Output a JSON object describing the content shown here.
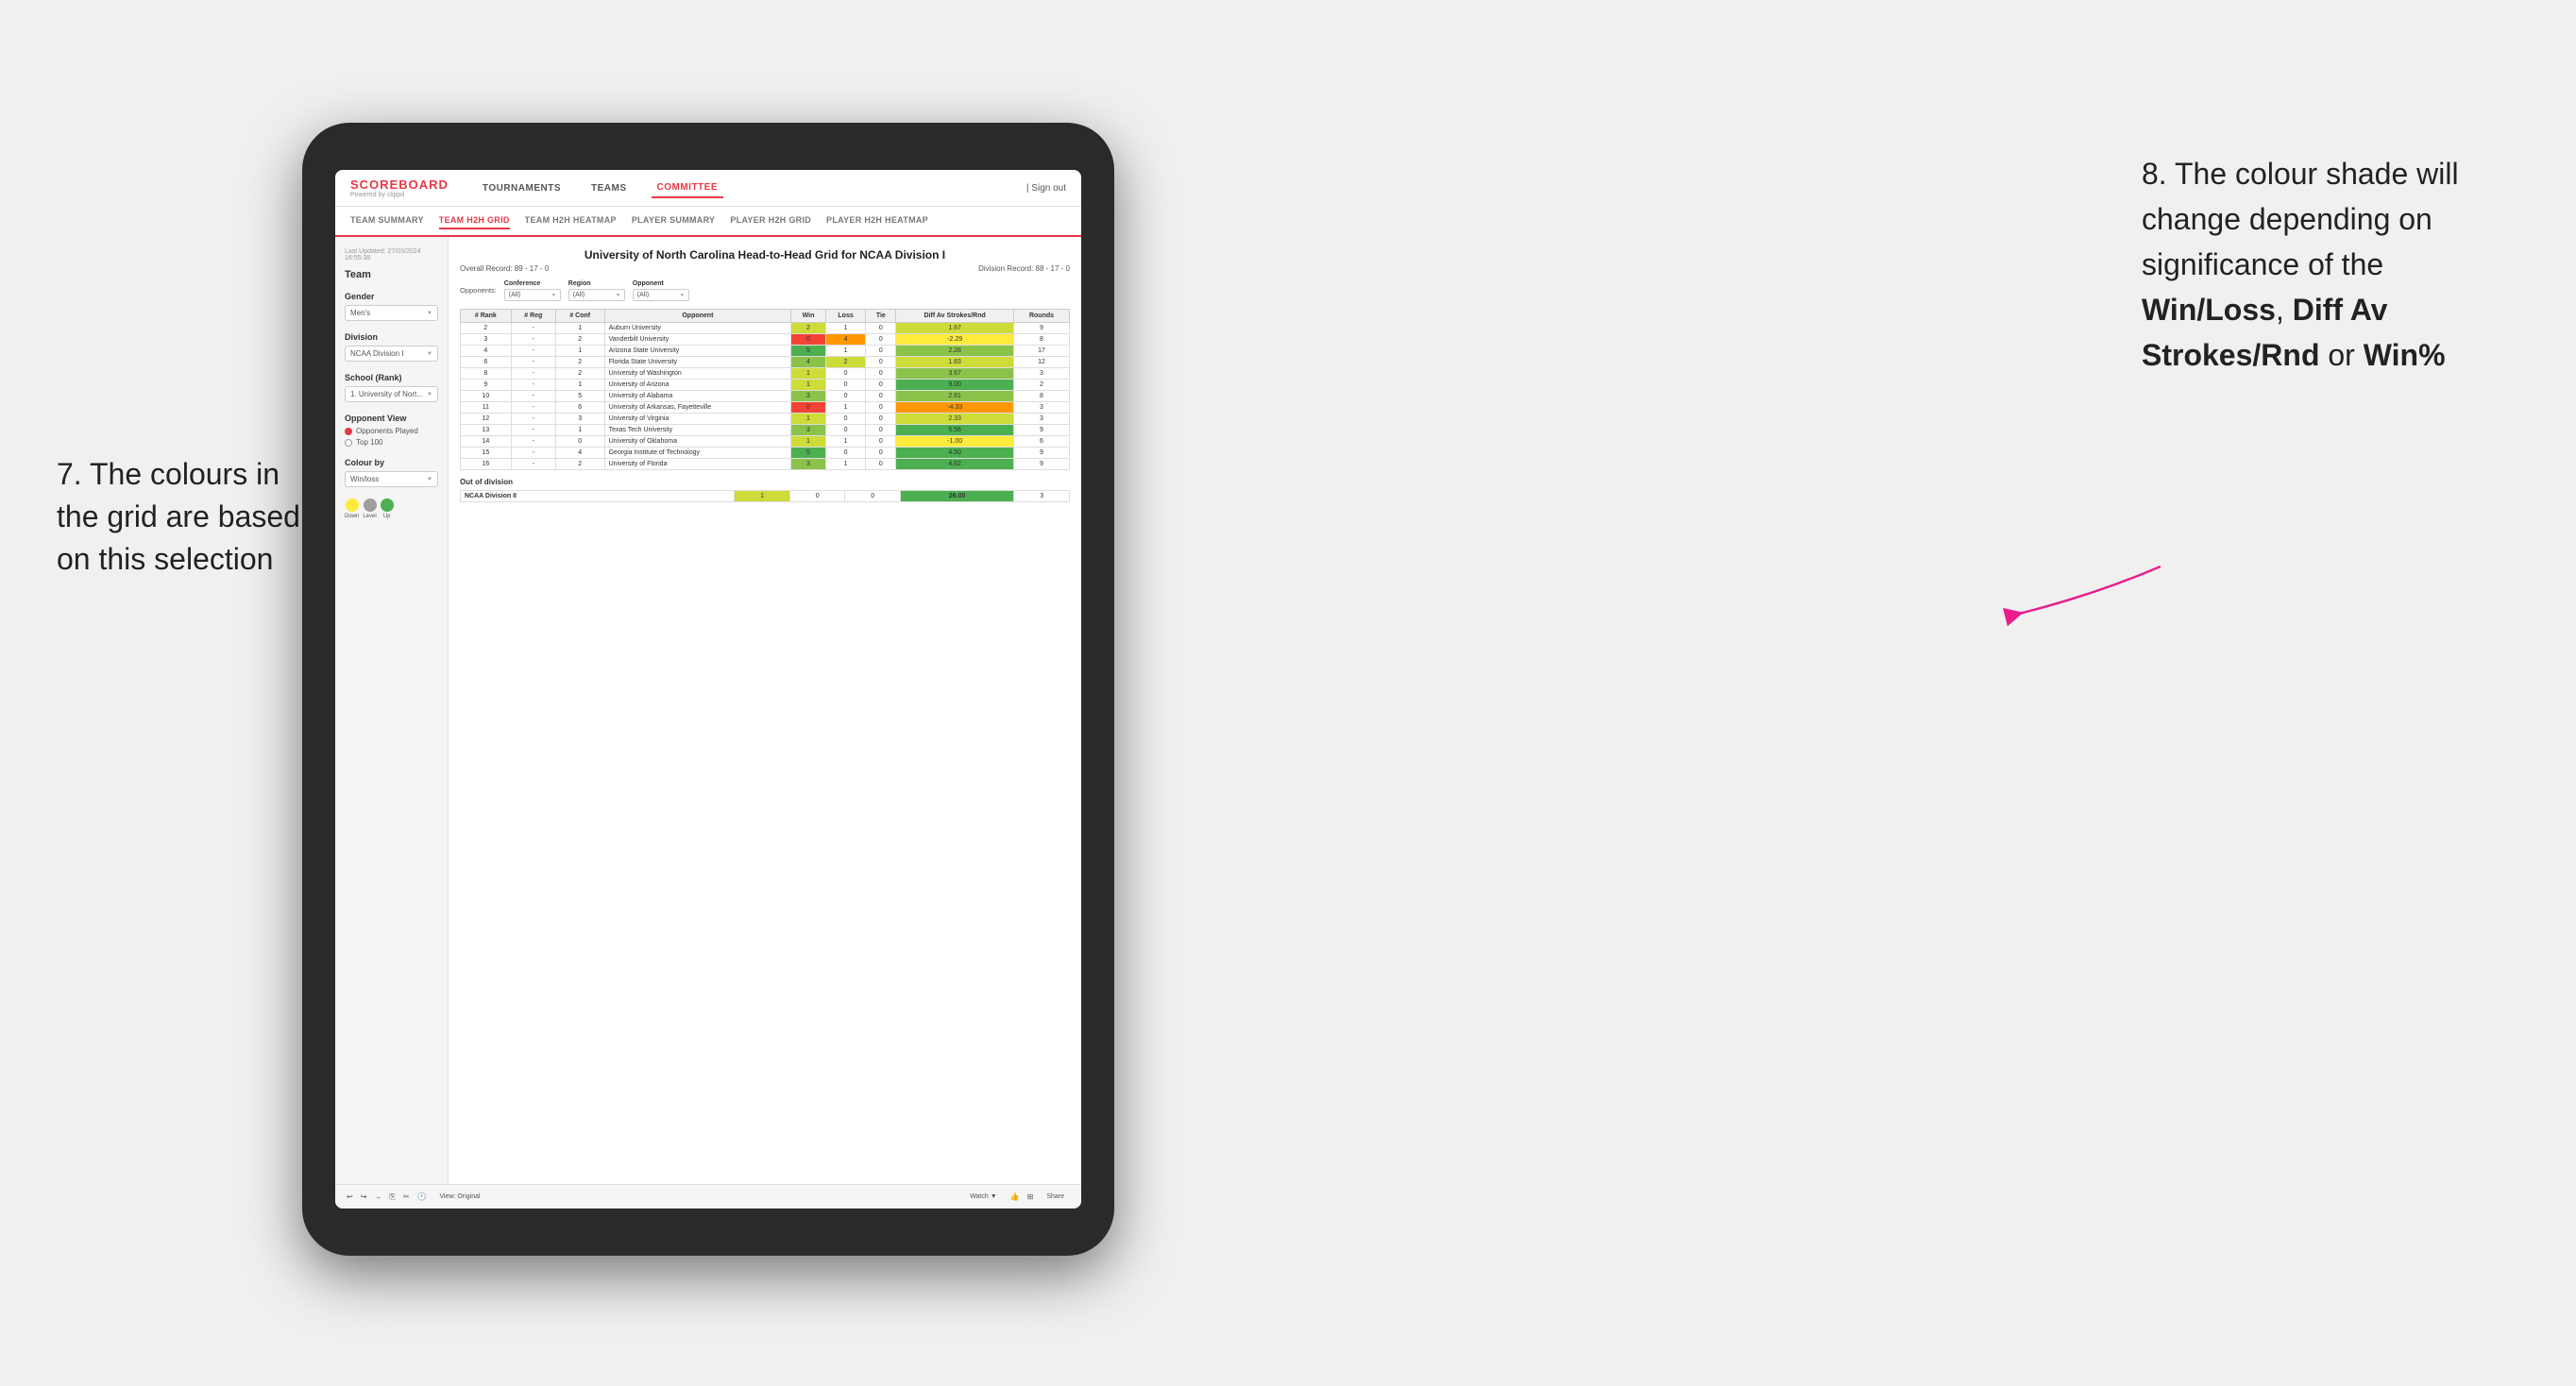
{
  "annotations": {
    "left": {
      "text": "7. The colours in the grid are based on this selection"
    },
    "right": {
      "line1": "8. The colour shade will change depending on significance of the ",
      "bold1": "Win/Loss",
      "sep1": ", ",
      "bold2": "Diff Av Strokes/Rnd",
      "sep2": " or ",
      "bold3": "Win%"
    }
  },
  "nav": {
    "logo": "SCOREBOARD",
    "logo_sub": "Powered by clippd",
    "items": [
      "TOURNAMENTS",
      "TEAMS",
      "COMMITTEE"
    ],
    "sign_out": "Sign out"
  },
  "sub_nav": {
    "items": [
      "TEAM SUMMARY",
      "TEAM H2H GRID",
      "TEAM H2H HEATMAP",
      "PLAYER SUMMARY",
      "PLAYER H2H GRID",
      "PLAYER H2H HEATMAP"
    ]
  },
  "sidebar": {
    "timestamp": "Last Updated: 27/03/2024\n16:55:38",
    "team_label": "Team",
    "gender_label": "Gender",
    "gender_value": "Men's",
    "division_label": "Division",
    "division_value": "NCAA Division I",
    "school_label": "School (Rank)",
    "school_value": "1. University of Nort...",
    "opponent_view_label": "Opponent View",
    "radio_options": [
      "Opponents Played",
      "Top 100"
    ],
    "radio_selected": 0,
    "colour_by_label": "Colour by",
    "colour_by_value": "Win/loss",
    "legend": {
      "down_label": "Down",
      "level_label": "Level",
      "up_label": "Up"
    }
  },
  "report": {
    "title": "University of North Carolina Head-to-Head Grid for NCAA Division I",
    "overall_record": "Overall Record: 89 - 17 - 0",
    "division_record": "Division Record: 88 - 17 - 0",
    "filter_labels": {
      "opponents": "Opponents:",
      "conference": "Conference",
      "region": "Region",
      "opponent": "Opponent"
    },
    "filter_values": {
      "opponents": "(All)",
      "conference": "(All)",
      "region": "(All)",
      "opponent": "(All)"
    },
    "table_headers": [
      "#\nRank",
      "#\nReg",
      "#\nConf",
      "Opponent",
      "Win",
      "Loss",
      "Tie",
      "Diff Av\nStrokes/Rnd",
      "Rounds"
    ],
    "rows": [
      {
        "rank": "2",
        "reg": "-",
        "conf": "1",
        "opponent": "Auburn University",
        "win": "2",
        "loss": "1",
        "tie": "0",
        "diff": "1.67",
        "rounds": "9",
        "win_color": "green_light",
        "loss_color": "white",
        "diff_color": "green_light"
      },
      {
        "rank": "3",
        "reg": "-",
        "conf": "2",
        "opponent": "Vanderbilt University",
        "win": "0",
        "loss": "4",
        "tie": "0",
        "diff": "-2.29",
        "rounds": "8",
        "win_color": "red",
        "loss_color": "orange",
        "diff_color": "yellow"
      },
      {
        "rank": "4",
        "reg": "-",
        "conf": "1",
        "opponent": "Arizona State University",
        "win": "5",
        "loss": "1",
        "tie": "0",
        "diff": "2.28",
        "rounds": "17",
        "win_color": "green_dark",
        "loss_color": "white",
        "diff_color": "green_med"
      },
      {
        "rank": "6",
        "reg": "-",
        "conf": "2",
        "opponent": "Florida State University",
        "win": "4",
        "loss": "2",
        "tie": "0",
        "diff": "1.83",
        "rounds": "12",
        "win_color": "green_med",
        "loss_color": "green_light",
        "diff_color": "green_light"
      },
      {
        "rank": "8",
        "reg": "-",
        "conf": "2",
        "opponent": "University of Washington",
        "win": "1",
        "loss": "0",
        "tie": "0",
        "diff": "3.67",
        "rounds": "3",
        "win_color": "green_light",
        "loss_color": "white",
        "diff_color": "green_med"
      },
      {
        "rank": "9",
        "reg": "-",
        "conf": "1",
        "opponent": "University of Arizona",
        "win": "1",
        "loss": "0",
        "tie": "0",
        "diff": "9.00",
        "rounds": "2",
        "win_color": "green_light",
        "loss_color": "white",
        "diff_color": "green_dark"
      },
      {
        "rank": "10",
        "reg": "-",
        "conf": "5",
        "opponent": "University of Alabama",
        "win": "3",
        "loss": "0",
        "tie": "0",
        "diff": "2.61",
        "rounds": "8",
        "win_color": "green_med",
        "loss_color": "white",
        "diff_color": "green_med"
      },
      {
        "rank": "11",
        "reg": "-",
        "conf": "6",
        "opponent": "University of Arkansas, Fayetteville",
        "win": "0",
        "loss": "1",
        "tie": "0",
        "diff": "-4.33",
        "rounds": "3",
        "win_color": "red",
        "loss_color": "white",
        "diff_color": "orange"
      },
      {
        "rank": "12",
        "reg": "-",
        "conf": "3",
        "opponent": "University of Virginia",
        "win": "1",
        "loss": "0",
        "tie": "0",
        "diff": "2.33",
        "rounds": "3",
        "win_color": "green_light",
        "loss_color": "white",
        "diff_color": "green_light"
      },
      {
        "rank": "13",
        "reg": "-",
        "conf": "1",
        "opponent": "Texas Tech University",
        "win": "3",
        "loss": "0",
        "tie": "0",
        "diff": "5.56",
        "rounds": "9",
        "win_color": "green_med",
        "loss_color": "white",
        "diff_color": "green_dark"
      },
      {
        "rank": "14",
        "reg": "-",
        "conf": "0",
        "opponent": "University of Oklahoma",
        "win": "1",
        "loss": "1",
        "tie": "0",
        "diff": "-1.00",
        "rounds": "6",
        "win_color": "green_light",
        "loss_color": "white",
        "diff_color": "yellow"
      },
      {
        "rank": "15",
        "reg": "-",
        "conf": "4",
        "opponent": "Georgia Institute of Technology",
        "win": "5",
        "loss": "0",
        "tie": "0",
        "diff": "4.50",
        "rounds": "9",
        "win_color": "green_dark",
        "loss_color": "white",
        "diff_color": "green_dark"
      },
      {
        "rank": "16",
        "reg": "-",
        "conf": "2",
        "opponent": "University of Florida",
        "win": "3",
        "loss": "1",
        "tie": "0",
        "diff": "4.62",
        "rounds": "9",
        "win_color": "green_med",
        "loss_color": "white",
        "diff_color": "green_dark"
      }
    ],
    "out_of_division_label": "Out of division",
    "out_of_division_rows": [
      {
        "division": "NCAA Division II",
        "win": "1",
        "loss": "0",
        "tie": "0",
        "diff": "26.00",
        "rounds": "3",
        "win_color": "green_light",
        "diff_color": "green_dark"
      }
    ]
  },
  "toolbar": {
    "view_label": "View: Original",
    "watch_label": "Watch ▼",
    "share_label": "Share"
  }
}
